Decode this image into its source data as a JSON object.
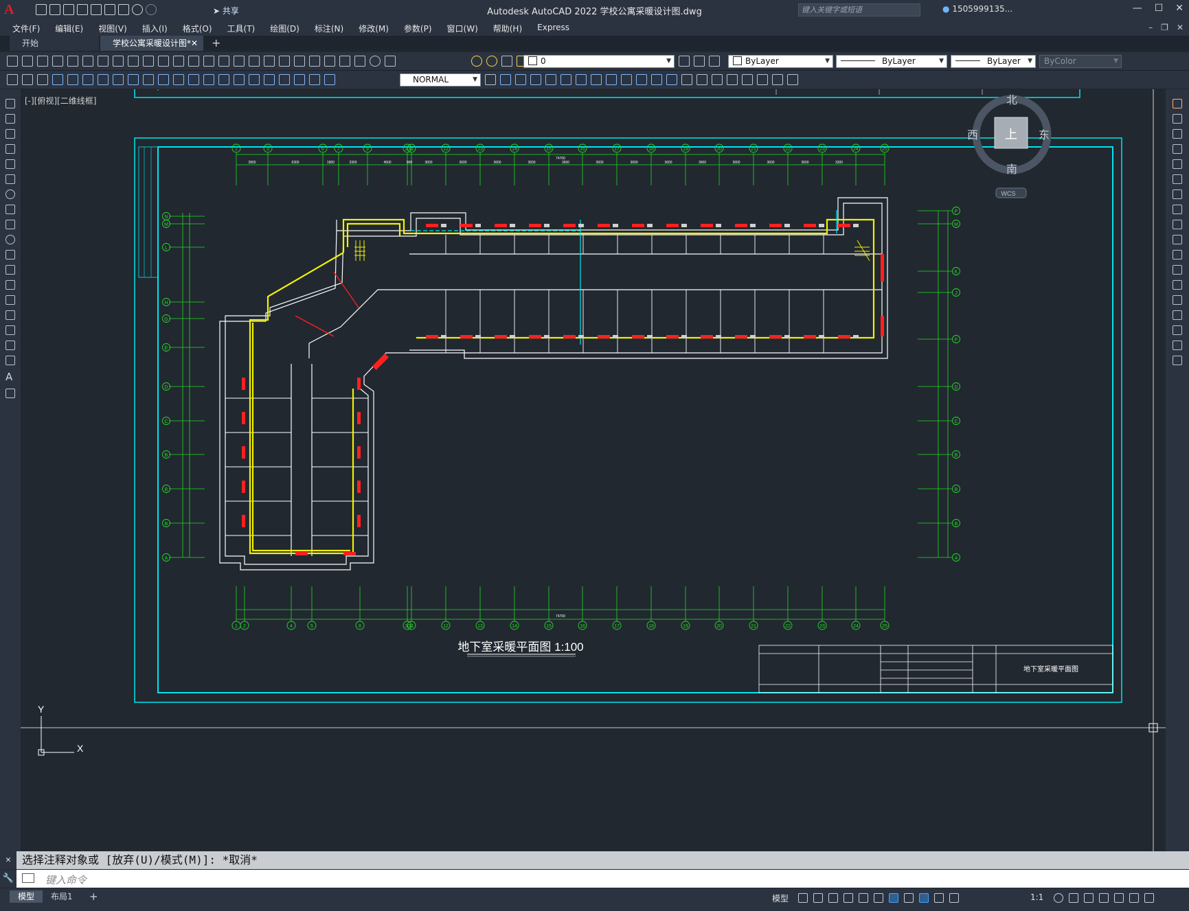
{
  "app": {
    "title": "Autodesk AutoCAD 2022    学校公寓采暖设计图.dwg",
    "share_label": "共享",
    "search_placeholder": "键入关键字或短语",
    "user": "1505999135..."
  },
  "menu": {
    "items": [
      "文件(F)",
      "编辑(E)",
      "视图(V)",
      "插入(I)",
      "格式(O)",
      "工具(T)",
      "绘图(D)",
      "标注(N)",
      "修改(M)",
      "参数(P)",
      "窗口(W)",
      "帮助(H)",
      "Express"
    ]
  },
  "tabs": {
    "start": "开始",
    "drawing": "学校公寓采暖设计图*",
    "add": "+"
  },
  "toolbar": {
    "layer_value": "0",
    "color_value": "ByLayer",
    "linetype_value": "ByLayer",
    "lineweight_value": "ByLayer",
    "plotstyle_value": "ByColor",
    "dimstyle_value": "NORMAL"
  },
  "viewport": {
    "label": "[-][俯视][二维线框]",
    "viewcube": {
      "north": "北",
      "south": "南",
      "east": "东",
      "west": "西",
      "face": "上",
      "wcs": "WCS"
    },
    "ucs": {
      "x": "X",
      "y": "Y"
    }
  },
  "drawing": {
    "plan_title": "地下室采暖平面图 1:100",
    "titleblock_name": "地下室采暖平面图",
    "top_axis_labels": [
      "1",
      "3",
      "6",
      "7",
      "9",
      "10",
      "11",
      "12",
      "13",
      "14",
      "15",
      "16",
      "17",
      "18",
      "19",
      "20",
      "21",
      "22",
      "23",
      "24",
      "25"
    ],
    "bottom_axis_labels": [
      "1",
      "2",
      "4",
      "5",
      "8",
      "10",
      "11",
      "12",
      "13",
      "14",
      "15",
      "16",
      "17",
      "18",
      "19",
      "20",
      "21",
      "22",
      "23",
      "24",
      "25"
    ],
    "left_axis_labels": [
      "N",
      "M",
      "L",
      "H",
      "G",
      "E",
      "D",
      "C",
      "B",
      "A"
    ],
    "right_axis_labels": [
      "P",
      "M",
      "K",
      "J",
      "F",
      "D",
      "C",
      "B",
      "A"
    ],
    "top_dims": [
      "2800",
      "6300",
      "1800",
      "3300",
      "4500",
      "900",
      "3600",
      "3600",
      "3600",
      "3600",
      "3600",
      "3600",
      "3600",
      "3600",
      "3600",
      "3600",
      "3600",
      "3600",
      "3300"
    ],
    "total_dim_top": "74700",
    "total_dim_bottom": "74700"
  },
  "command": {
    "history": "选择注释对象或 [放弃(U)/模式(M)]: *取消*",
    "placeholder": "键入命令"
  },
  "status": {
    "model_tab": "模型",
    "layout1_tab": "布局1",
    "add_tab": "+",
    "model_label": "模型",
    "scale": "1:1"
  },
  "colors": {
    "background": "#212830",
    "frame": "#00e5ee",
    "grid": "#22dd22",
    "walls": "#ffffff",
    "supply_pipe": "#f2f200",
    "radiator": "#ff2a2a"
  }
}
